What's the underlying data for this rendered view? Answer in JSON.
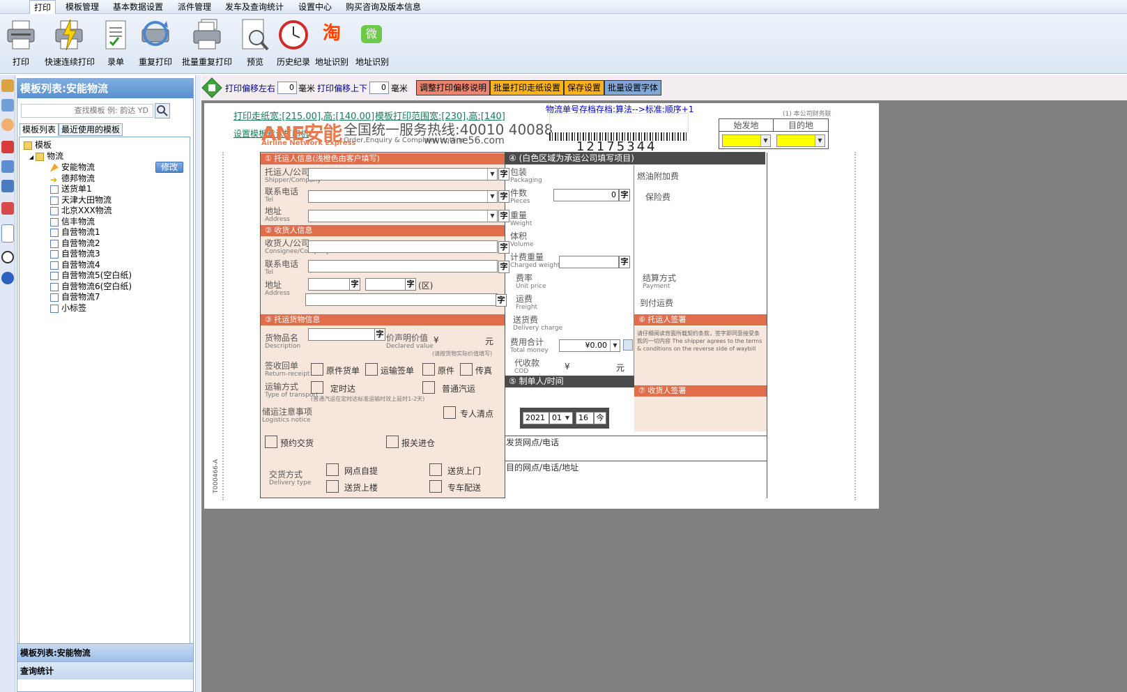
{
  "menu": [
    "打印",
    "模板管理",
    "基本数据设置",
    "派件管理",
    "发车及查询统计",
    "设置中心",
    "购买咨询及版本信息"
  ],
  "toolbar": [
    "打印",
    "快速连续打印",
    "录单",
    "重复打印",
    "批量重复打印",
    "预览",
    "历史纪录",
    "地址识别",
    "地址识别"
  ],
  "toolbar_icons": {
    "taobao_char": "淘",
    "wechat_char": "微"
  },
  "panel": {
    "title": "模板列表:安能物流",
    "search_placeholder": "查找模板 例: 韵达 YD",
    "tabs": [
      "模板列表",
      "最近使用的模板"
    ],
    "tree_root": "模板",
    "tree_group": "物流",
    "tree_items": [
      "安能物流",
      "德邦物流",
      "送货单1",
      "天津大田物流",
      "北京XXX物流",
      "信丰物流",
      "自营物流1",
      "自营物流2",
      "自营物流3",
      "自营物流4",
      "自营物流5(空白纸)",
      "自营物流6(空白纸)",
      "自营物流7",
      "小标签"
    ],
    "edit_btn": "修改",
    "bottom_tab1": "模板列表:安能物流",
    "bottom_tab2": "查询统计"
  },
  "controls": {
    "lr_label": "打印偏移左右",
    "lr_value": "0",
    "ud_label": "打印偏移上下",
    "ud_value": "0",
    "unit": "毫米",
    "btn1": "调整打印偏移说明",
    "btn2": "批量打印走纸设置",
    "btn3": "保存设置",
    "btn4": "批量设置字体"
  },
  "paper": {
    "size_text": "打印走纸宽:[215.00],高:[140.00]",
    "range_text": "模板打印范围宽:[230],高:[140]",
    "set_link": "设置模板默认打印机",
    "archive_text": "物流单号存档存档:算法-->标准:顺序+1",
    "barcode_num": "12175344",
    "company_tag": "(1) 本公司财务联",
    "origin": "始发地",
    "dest": "目的地",
    "logo_en": "Airline Network Express",
    "logo_cn": "ANE安能",
    "hotline": "全国统一服务热线:40010 40088",
    "hotline_en": "Order,Enquiry & Complaint Hotline",
    "website": "www.ane56.com",
    "side_code": "T000466-A"
  },
  "form": {
    "sec1": "① 托运人信息(浅橙色由客户填写)",
    "sec2": "② 收货人信息",
    "sec3": "③ 托运货物信息",
    "sec4": "④ (白色区域为承运公司填写项目)",
    "sec5": "⑤ 制单人/时间",
    "sec6": "⑥ 托运人签署",
    "sec7": "⑦ 收货人签署",
    "shipper": "托运人/公司",
    "shipper_en": "Shipper/Company",
    "tel": "联系电话",
    "tel_en": "Tel",
    "addr": "地址",
    "addr_en": "Address",
    "consignee": "收货人/公司",
    "consignee_en": "Consignee/Company",
    "district": "(区)",
    "goods": "货物品名",
    "goods_en": "Description",
    "declared": "价声明价值",
    "declared_en": "Declared value",
    "yuan": "元",
    "yen": "¥",
    "declared_note": "(请按货物实际价值填写)",
    "receipt": "签收回单",
    "receipt_en": "Return-receipt",
    "r1": "原件货单",
    "r2": "运输签单",
    "r3": "原件",
    "r4": "传真",
    "transport": "运输方式",
    "transport_en": "Type of transport",
    "t1": "定时达",
    "t2": "普通汽运",
    "transport_note": "(普通汽运在定时达标准运输时效上延时1-2天)",
    "notice": "储运注意事项",
    "notice_en": "Logistics notice",
    "n1": "专人清点",
    "n2": "预约交货",
    "n3": "报关进仓",
    "delivery": "交货方式",
    "delivery_en": "Delivery type",
    "d1": "网点自提",
    "d2": "送货上门",
    "d3": "送货上楼",
    "d4": "专车配送",
    "pack": "包装",
    "pack_en": "Packaging",
    "pieces": "件数",
    "pieces_en": "Pieces",
    "pieces_val": "0",
    "weight": "重量",
    "weight_en": "Weight",
    "volume": "体积",
    "volume_en": "Volume",
    "charged": "计费重量",
    "charged_en": "Charged weight",
    "rate": "费率",
    "rate_en": "Unit price",
    "freight": "运费",
    "freight_en": "Freight",
    "dcharge": "送货费",
    "dcharge_en": "Delivery charge",
    "total": "费用合计",
    "total_en": "Total money",
    "total_val": "¥0.00",
    "cod": "代收款",
    "cod_en": "COD",
    "fuel": "燃油附加费",
    "insurance": "保险费",
    "payment": "结算方式",
    "payment_en": "Payment",
    "topay": "到付运费",
    "agree": "请仔细阅读背面所载契约条款，签字即同意接受条款的一切内容 The shipper agrees to the terms & conditions on the reverse side of waybill",
    "year": "2021",
    "month": "01",
    "day": "16",
    "today": "今",
    "branch": "发货网点/电话",
    "dest_branch": "目的网点/电话/地址",
    "zi": "字"
  },
  "colors": {
    "accent": "#e06e4a",
    "yellow": "#ffff00",
    "blue_link": "#0000cc"
  }
}
